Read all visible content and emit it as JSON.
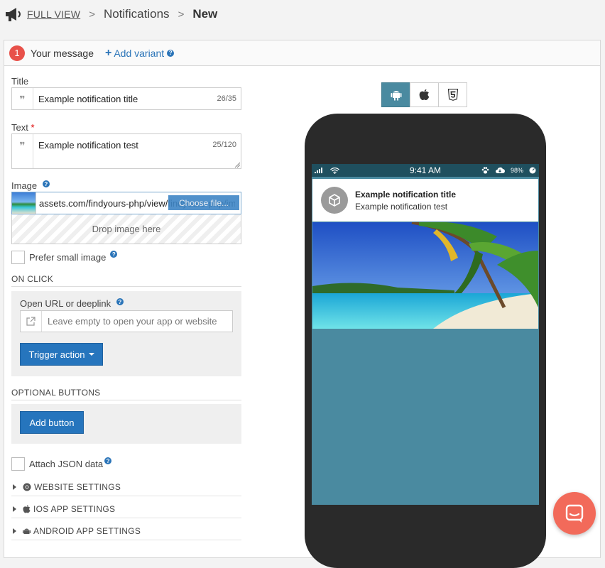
{
  "breadcrumb": {
    "full_view": "FULL VIEW",
    "sep": ">",
    "section": "Notifications",
    "current": "New"
  },
  "message_header": {
    "step": "1",
    "title": "Your message",
    "add_variant": "Add variant"
  },
  "title_field": {
    "label": "Title",
    "value": "Example notification title",
    "counter": "26/35"
  },
  "text_field": {
    "label": "Text",
    "required_mark": "*",
    "value": "Example notification test",
    "counter": "25/120"
  },
  "image_field": {
    "label": "Image",
    "url": "assets.com/findyours-php/view/findyours-php/images/",
    "choose_label": "Choose file...",
    "drop_label": "Drop image here"
  },
  "prefer_small": {
    "label": "Prefer small image"
  },
  "on_click": {
    "section": "ON CLICK",
    "url_label": "Open URL or deeplink",
    "url_placeholder": "Leave empty to open your app or website",
    "trigger_label": "Trigger action"
  },
  "optional_buttons": {
    "section": "OPTIONAL BUTTONS",
    "add_label": "Add button"
  },
  "json_data": {
    "label": "Attach JSON data"
  },
  "accordions": [
    {
      "label": "WEBSITE SETTINGS",
      "icon": "chrome-icon"
    },
    {
      "label": "IOS APP SETTINGS",
      "icon": "apple-icon"
    },
    {
      "label": "ANDROID APP SETTINGS",
      "icon": "android-icon"
    }
  ],
  "platforms": [
    {
      "name": "android-icon",
      "active": true
    },
    {
      "name": "apple-icon",
      "active": false
    },
    {
      "name": "html5-icon",
      "active": false
    }
  ],
  "preview": {
    "time": "9:41 AM",
    "battery": "98%",
    "title": "Example notification title",
    "text": "Example notification test"
  },
  "colors": {
    "accent": "#2675bd",
    "step_badge": "#e8514a",
    "preview_bg": "#4a8aa0",
    "chat": "#f26a5a"
  }
}
